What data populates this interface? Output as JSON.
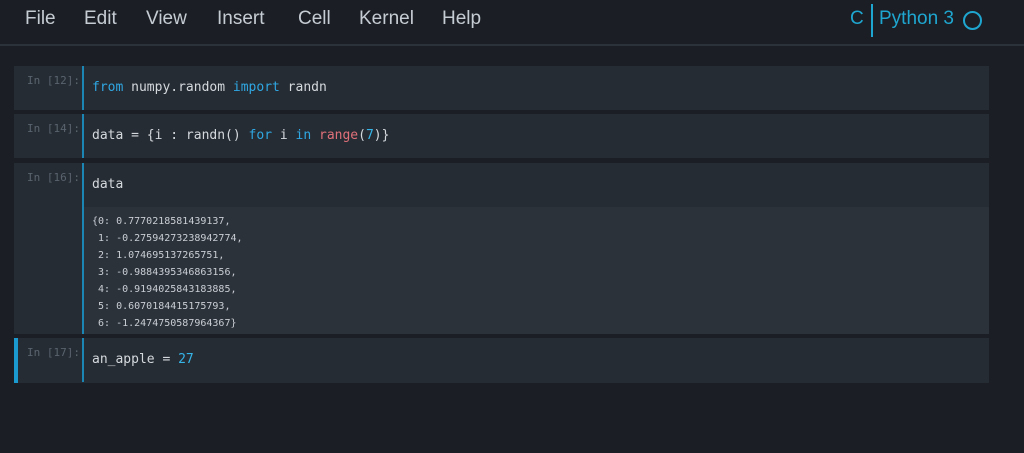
{
  "menu": {
    "items": [
      "File",
      "Edit",
      "View",
      "Insert",
      "Cell",
      "Kernel",
      "Help"
    ]
  },
  "kernel": {
    "letter": "C",
    "name": "Python 3",
    "status_icon": "circle-idle-icon"
  },
  "cells": [
    {
      "prompt": "In [12]:",
      "code": [
        {
          "t": "from",
          "c": "kw"
        },
        {
          "t": " numpy.random ",
          "c": ""
        },
        {
          "t": "import",
          "c": "kw"
        },
        {
          "t": " randn",
          "c": ""
        }
      ]
    },
    {
      "prompt": "In [14]:",
      "code": [
        {
          "t": "data = {i : randn() ",
          "c": ""
        },
        {
          "t": "for",
          "c": "kw"
        },
        {
          "t": " i ",
          "c": ""
        },
        {
          "t": "in",
          "c": "kw"
        },
        {
          "t": " ",
          "c": ""
        },
        {
          "t": "range",
          "c": "bi"
        },
        {
          "t": "(",
          "c": ""
        },
        {
          "t": "7",
          "c": "num"
        },
        {
          "t": ")}",
          "c": ""
        }
      ]
    },
    {
      "prompt": "In [16]:",
      "code": [
        {
          "t": "data",
          "c": ""
        }
      ],
      "output": [
        "{0: 0.7770218581439137,",
        " 1: -0.27594273238942774,",
        " 2: 1.074695137265751,",
        " 3: -0.9884395346863156,",
        " 4: -0.9194025843183885,",
        " 5: 0.6070184415175793,",
        " 6: -1.2474750587964367}"
      ]
    },
    {
      "prompt": "In [17]:",
      "code": [
        {
          "t": "an_apple = ",
          "c": ""
        },
        {
          "t": "27",
          "c": "num"
        }
      ]
    }
  ],
  "colors": {
    "background": "#1b1f25",
    "cell": "#262c33",
    "accent": "#1fa6d0",
    "keyword": "#2fa7e3",
    "builtin": "#e0707a"
  }
}
